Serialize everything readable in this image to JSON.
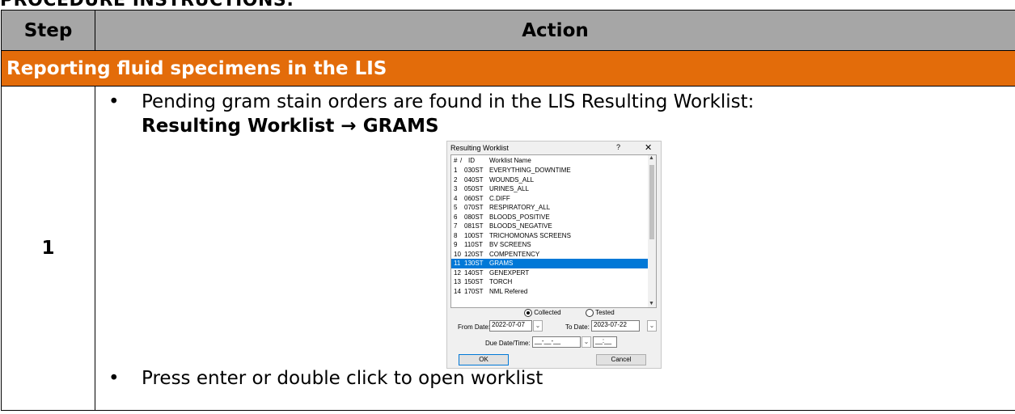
{
  "heading": "PROCEDURE INSTRUCTIONS:",
  "table": {
    "col_step": "Step",
    "col_action": "Action",
    "section_title": "Reporting fluid specimens in the LIS",
    "step_number": "1",
    "bullet1_line1": "Pending gram stain orders are found in the LIS Resulting Worklist:",
    "bullet1_line2": "Resulting Worklist → GRAMS",
    "bullet2": "Press enter or double click to open worklist",
    "bullet_glyph": "•"
  },
  "dialog": {
    "title": "Resulting Worklist",
    "help": "?",
    "close": "✕",
    "headers": {
      "num": "#",
      "sort": "/",
      "id": "ID",
      "name": "Worklist Name"
    },
    "rows": [
      {
        "num": "1",
        "id": "030ST",
        "name": "EVERYTHING_DOWNTIME"
      },
      {
        "num": "2",
        "id": "040ST",
        "name": "WOUNDS_ALL"
      },
      {
        "num": "3",
        "id": "050ST",
        "name": "URINES_ALL"
      },
      {
        "num": "4",
        "id": "060ST",
        "name": "C.DIFF"
      },
      {
        "num": "5",
        "id": "070ST",
        "name": "RESPIRATORY_ALL"
      },
      {
        "num": "6",
        "id": "080ST",
        "name": "BLOODS_POSITIVE"
      },
      {
        "num": "7",
        "id": "081ST",
        "name": "BLOODS_NEGATIVE"
      },
      {
        "num": "8",
        "id": "100ST",
        "name": "TRICHOMONAS SCREENS"
      },
      {
        "num": "9",
        "id": "110ST",
        "name": "BV SCREENS"
      },
      {
        "num": "10",
        "id": "120ST",
        "name": "COMPENTENCY"
      },
      {
        "num": "11",
        "id": "130ST",
        "name": "GRAMS"
      },
      {
        "num": "12",
        "id": "140ST",
        "name": "GENEXPERT"
      },
      {
        "num": "13",
        "id": "150ST",
        "name": "TORCH"
      },
      {
        "num": "14",
        "id": "170ST",
        "name": "NML Refered"
      }
    ],
    "selected_index": 10,
    "radio_collected": "Collected",
    "radio_tested": "Tested",
    "from_date_label": "From Date:",
    "from_date": "2022-07-07",
    "to_date_label": "To Date:",
    "to_date": "2023-07-22",
    "due_label": "Due Date/Time:",
    "due_date": "__-__-__",
    "due_time": "__:__",
    "ok": "OK",
    "cancel": "Cancel",
    "colors": {
      "selection": "#0078d7",
      "section_bar": "#e36c0a",
      "header_bar": "#a6a6a6"
    }
  }
}
